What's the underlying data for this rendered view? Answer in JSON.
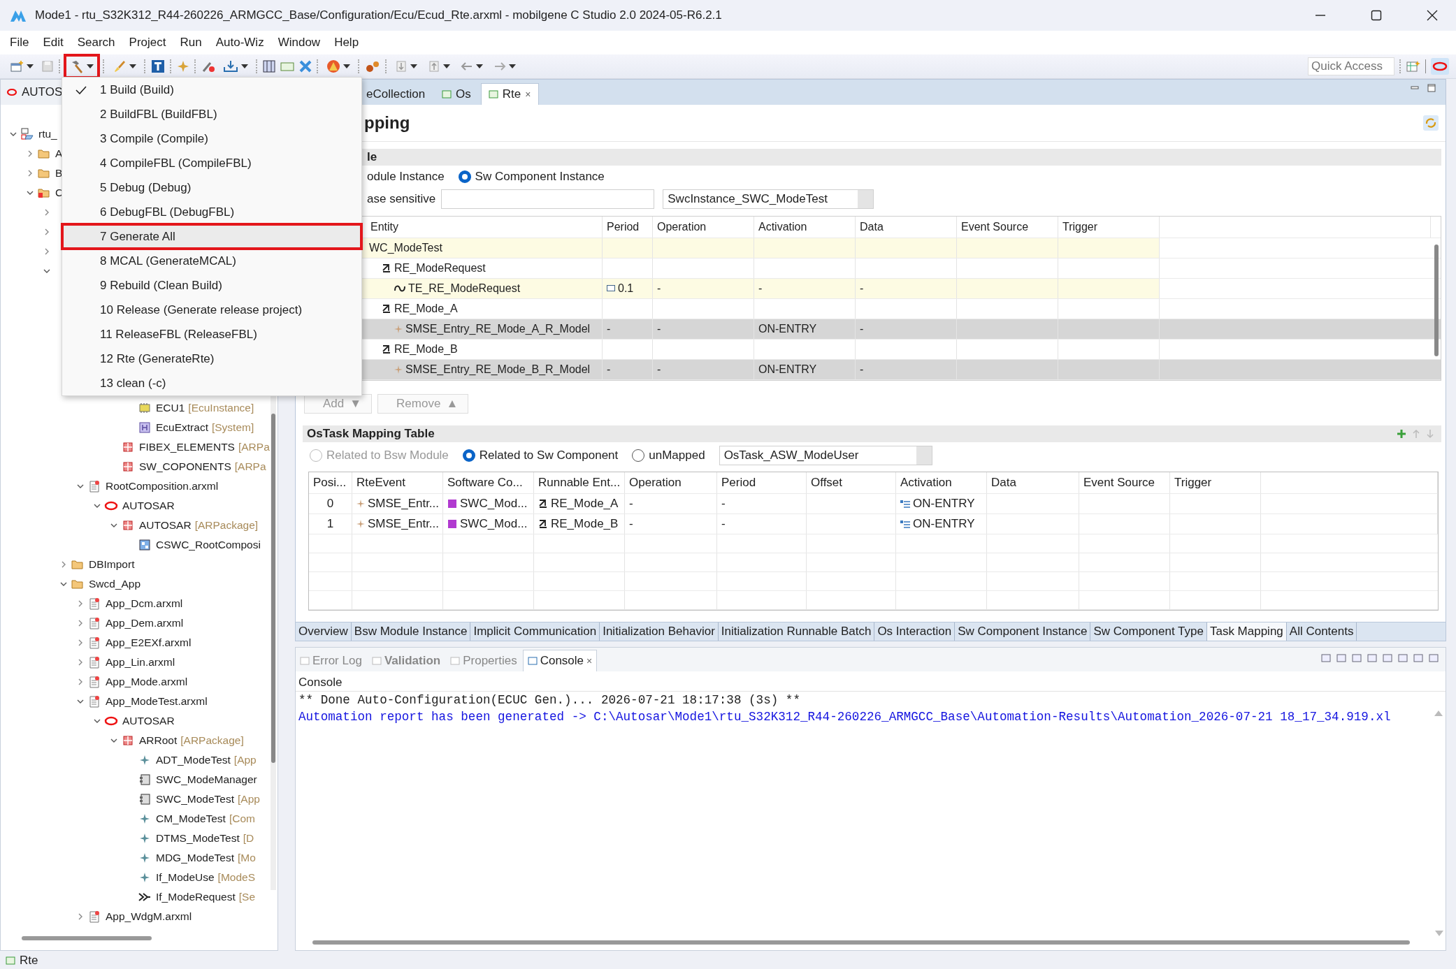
{
  "window": {
    "title": "Mode1 - rtu_S32K312_R44-260226_ARMGCC_Base/Configuration/Ecu/Ecud_Rte.arxml - mobilgene C Studio 2.0 2024-05-R6.2.1"
  },
  "menu_bar": [
    "File",
    "Edit",
    "Search",
    "Project",
    "Run",
    "Auto-Wiz",
    "Window",
    "Help"
  ],
  "toolbar": {
    "build_button": {
      "highlighted": true
    },
    "quick_access": {
      "placeholder": "Quick Access"
    }
  },
  "build_menu": [
    {
      "label": "1 Build (Build)",
      "checked": true,
      "highlighted": false
    },
    {
      "label": "2 BuildFBL (BuildFBL)",
      "checked": false,
      "highlighted": false
    },
    {
      "label": "3 Compile (Compile)",
      "checked": false,
      "highlighted": false
    },
    {
      "label": "4 CompileFBL (CompileFBL)",
      "checked": false,
      "highlighted": false
    },
    {
      "label": "5 Debug (Debug)",
      "checked": false,
      "highlighted": false
    },
    {
      "label": "6 DebugFBL (DebugFBL)",
      "checked": false,
      "highlighted": false
    },
    {
      "label": "7 Generate All",
      "checked": false,
      "highlighted": true
    },
    {
      "label": "8 MCAL (GenerateMCAL)",
      "checked": false,
      "highlighted": false
    },
    {
      "label": "9 Rebuild (Clean  Build)",
      "checked": false,
      "highlighted": false
    },
    {
      "label": "10 Release (Generate release project)",
      "checked": false,
      "highlighted": false
    },
    {
      "label": "11 ReleaseFBL (ReleaseFBL)",
      "checked": false,
      "highlighted": false
    },
    {
      "label": "12 Rte (GenerateRte)",
      "checked": false,
      "highlighted": false
    },
    {
      "label": "13 clean (-c)",
      "checked": false,
      "highlighted": false
    }
  ],
  "explorer": {
    "tab": "AUTOS",
    "tree": [
      {
        "label": "rtu_",
        "kind": "project",
        "expanded": true,
        "children": [
          {
            "label": "A",
            "kind": "folder",
            "expanded": false
          },
          {
            "label": "B",
            "kind": "folder",
            "expanded": false
          },
          {
            "label": "C",
            "kind": "error-folder",
            "expanded": true,
            "children": [
              {
                "expanded": false
              },
              {
                "expanded": false
              },
              {
                "expanded": false
              },
              {
                "expanded": true,
                "children": [
                  {
                    "children": [
                      {
                        "children": [
                          {
                            "children": [
                              {
                                "children": [
                                  {
                                    "label": "ECU1",
                                    "suffix": "[EcuInstance]",
                                    "kind": "ecu"
                                  },
                                  {
                                    "label": "EcuExtract",
                                    "suffix": "[System]",
                                    "kind": "system"
                                  }
                                ]
                              },
                              {
                                "label": "FIBEX_ELEMENTS",
                                "suffix": "[ARPa",
                                "kind": "package"
                              },
                              {
                                "label": "SW_COPONENTS",
                                "suffix": "[ARPa",
                                "kind": "package"
                              }
                            ]
                          }
                        ]
                      },
                      {
                        "label": "RootComposition.arxml",
                        "kind": "file",
                        "expanded": true,
                        "children": [
                          {
                            "label": "AUTOSAR",
                            "kind": "autosar",
                            "expanded": true,
                            "children": [
                              {
                                "label": "AUTOSAR",
                                "suffix": "[ARPackage]",
                                "kind": "package",
                                "expanded": true,
                                "children": [
                                  {
                                    "label": "CSWC_RootComposi",
                                    "kind": "composition"
                                  }
                                ]
                              }
                            ]
                          }
                        ]
                      }
                    ]
                  },
                  {
                    "label": "DBImport",
                    "kind": "folder",
                    "expanded": false
                  },
                  {
                    "label": "Swcd_App",
                    "kind": "folder",
                    "expanded": true,
                    "children": [
                      {
                        "label": "App_Dcm.arxml",
                        "kind": "file",
                        "expanded": false
                      },
                      {
                        "label": "App_Dem.arxml",
                        "kind": "file",
                        "expanded": false
                      },
                      {
                        "label": "App_E2EXf.arxml",
                        "kind": "file",
                        "expanded": false
                      },
                      {
                        "label": "App_Lin.arxml",
                        "kind": "file",
                        "expanded": false
                      },
                      {
                        "label": "App_Mode.arxml",
                        "kind": "file",
                        "expanded": false
                      },
                      {
                        "label": "App_ModeTest.arxml",
                        "kind": "file",
                        "expanded": true,
                        "children": [
                          {
                            "label": "AUTOSAR",
                            "kind": "autosar",
                            "expanded": true,
                            "children": [
                              {
                                "label": "ARRoot",
                                "suffix": "[ARPackage]",
                                "kind": "package",
                                "expanded": true,
                                "children": [
                                  {
                                    "label": "ADT_ModeTest",
                                    "suffix": "[App",
                                    "kind": "element"
                                  },
                                  {
                                    "label": "SWC_ModeManager",
                                    "kind": "component"
                                  },
                                  {
                                    "label": "SWC_ModeTest",
                                    "suffix": "[App",
                                    "kind": "component"
                                  },
                                  {
                                    "label": "CM_ModeTest",
                                    "suffix": "[Com",
                                    "kind": "element"
                                  },
                                  {
                                    "label": "DTMS_ModeTest",
                                    "suffix": "[D",
                                    "kind": "element"
                                  },
                                  {
                                    "label": "MDG_ModeTest",
                                    "suffix": "[Mo",
                                    "kind": "element"
                                  },
                                  {
                                    "label": "If_ModeUse",
                                    "suffix": "[ModeS",
                                    "kind": "element"
                                  },
                                  {
                                    "label": "If_ModeRequest",
                                    "suffix": "[Se",
                                    "kind": "interface"
                                  }
                                ]
                              }
                            ]
                          }
                        ]
                      },
                      {
                        "label": "App_WdgM.arxml",
                        "kind": "file",
                        "expanded": false
                      }
                    ]
                  }
                ]
              }
            ]
          }
        ]
      }
    ]
  },
  "editor": {
    "tabs": [
      {
        "label": "eCollection",
        "selected": false
      },
      {
        "label": "Os",
        "selected": false
      },
      {
        "label": "Rte",
        "selected": true,
        "close": "×"
      }
    ],
    "heading": "pping",
    "section": "le",
    "filter_options": [
      {
        "label": "odule Instance"
      },
      {
        "label": "Sw Component Instance",
        "selected": true
      }
    ],
    "filter_label": "ase sensitive",
    "instance_combo": "SwcInstance_SWC_ModeTest",
    "entity_table": {
      "columns": [
        "Entity",
        "Period",
        "Operation",
        "Activation",
        "Data",
        "Event Source",
        "Trigger"
      ],
      "rows": [
        {
          "entity": "WC_ModeTest",
          "kind": "instance",
          "selected": false,
          "children": [
            {
              "entity": "RE_ModeRequest",
              "kind": "runnable",
              "selected": false,
              "children": [
                {
                  "entity": "TE_RE_ModeRequest",
                  "kind": "timing-event",
                  "selected": false,
                  "cells": [
                    "0.1",
                    "-",
                    "-",
                    "-",
                    null,
                    null
                  ]
                }
              ]
            },
            {
              "entity": "RE_Mode_A",
              "kind": "runnable",
              "selected": false,
              "children": [
                {
                  "entity": "SMSE_Entry_RE_Mode_A_R_Model",
                  "kind": "mode-event",
                  "selected": true,
                  "cells": [
                    "-",
                    "-",
                    "ON-ENTRY",
                    "-",
                    null,
                    null
                  ]
                }
              ]
            },
            {
              "entity": "RE_Mode_B",
              "kind": "runnable",
              "selected": false,
              "children": [
                {
                  "entity": "SMSE_Entry_RE_Mode_B_R_Model",
                  "kind": "mode-event",
                  "selected": true,
                  "cells": [
                    "-",
                    "-",
                    "ON-ENTRY",
                    "-",
                    null,
                    null
                  ]
                }
              ]
            }
          ]
        }
      ]
    },
    "buttons": [
      {
        "label": "Add",
        "arrow": "▼",
        "disabled": true
      },
      {
        "label": "Remove",
        "arrow": "▲",
        "disabled": true
      }
    ],
    "ostask": {
      "title": "OsTask Mapping Table",
      "options": [
        {
          "label": "Related to Bsw Module",
          "selected": false,
          "disabled": true
        },
        {
          "label": "Related to Sw Component",
          "selected": true,
          "disabled": false
        },
        {
          "label": "unMapped",
          "selected": false,
          "disabled": false
        }
      ],
      "task_combo": "OsTask_ASW_ModeUser",
      "columns": [
        "Posi...",
        "RteEvent",
        "Software Co...",
        "Runnable Ent...",
        "Operation",
        "Period",
        "Offset",
        "Activation",
        "Data",
        "Event Source",
        "Trigger"
      ],
      "rows": [
        [
          "0",
          "SMSE_Entr...",
          "SWC_Mod...",
          "RE_Mode_A",
          "-",
          "-",
          null,
          "ON-ENTRY",
          null,
          null,
          null
        ],
        [
          "1",
          "SMSE_Entr...",
          "SWC_Mod...",
          "RE_Mode_B",
          "-",
          "-",
          null,
          "ON-ENTRY",
          null,
          null,
          null
        ]
      ]
    },
    "pages": [
      {
        "label": "Overview",
        "selected": false
      },
      {
        "label": "Bsw Module Instance",
        "selected": false
      },
      {
        "label": "Implicit Communication",
        "selected": false
      },
      {
        "label": "Initialization Behavior",
        "selected": false
      },
      {
        "label": "Initialization Runnable Batch",
        "selected": false
      },
      {
        "label": "Os Interaction",
        "selected": false
      },
      {
        "label": "Sw Component Instance",
        "selected": false
      },
      {
        "label": "Sw Component Type",
        "selected": false
      },
      {
        "label": "Task Mapping",
        "selected": true
      },
      {
        "label": "All Contents",
        "selected": false
      }
    ]
  },
  "console": {
    "tabs": [
      {
        "label": "Error Log",
        "selected": false
      },
      {
        "label": "Validation",
        "selected": false
      },
      {
        "label": "Properties",
        "selected": false
      },
      {
        "label": "Console",
        "selected": true,
        "close": "×"
      }
    ],
    "title": "Console",
    "lines": [
      {
        "text": "** Done Auto-Configuration(ECUC Gen.)... 2026-07-21 18:17:38 (3s) **",
        "kind": "plain"
      },
      {
        "text": "Automation report has been generated -> C:\\Autosar\\Mode1\\rtu_S32K312_R44-260226_ARMGCC_Base\\Automation-Results\\Automation_2026-07-21 18_17_34.919.xl",
        "kind": "link"
      }
    ]
  },
  "status_bar": {
    "text": "Rte"
  }
}
